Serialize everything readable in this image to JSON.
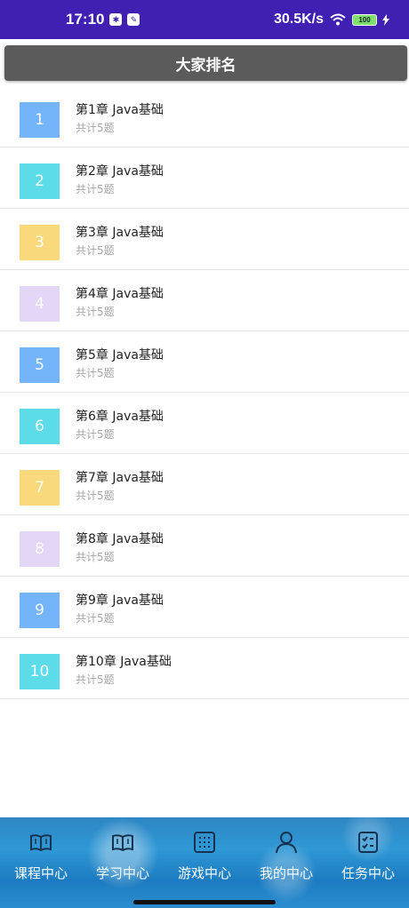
{
  "status_bar": {
    "time": "17:10",
    "icons": [
      "settings-mini-icon",
      "app-mini-icon"
    ],
    "network_speed": "30.5K/s",
    "battery": "100"
  },
  "header": {
    "title": "大家排名"
  },
  "chapters": [
    {
      "number": "1",
      "title": "第1章 Java基础",
      "subtitle": "共计5题",
      "color": "#74b4fb"
    },
    {
      "number": "2",
      "title": "第2章 Java基础",
      "subtitle": "共计5题",
      "color": "#5cdbe8"
    },
    {
      "number": "3",
      "title": "第3章 Java基础",
      "subtitle": "共计5题",
      "color": "#f9d97b"
    },
    {
      "number": "4",
      "title": "第4章 Java基础",
      "subtitle": "共计5题",
      "color": "#e3d6f7"
    },
    {
      "number": "5",
      "title": "第5章 Java基础",
      "subtitle": "共计5题",
      "color": "#74b4fb"
    },
    {
      "number": "6",
      "title": "第6章 Java基础",
      "subtitle": "共计5题",
      "color": "#5cdbe8"
    },
    {
      "number": "7",
      "title": "第7章 Java基础",
      "subtitle": "共计5题",
      "color": "#f9d97b"
    },
    {
      "number": "8",
      "title": "第8章 Java基础",
      "subtitle": "共计5题",
      "color": "#e3d6f7"
    },
    {
      "number": "9",
      "title": "第9章 Java基础",
      "subtitle": "共计5题",
      "color": "#74b4fb"
    },
    {
      "number": "10",
      "title": "第10章 Java基础",
      "subtitle": "共计5题",
      "color": "#5cdbe8"
    }
  ],
  "bottom_nav": [
    {
      "label": "课程中心",
      "icon": "book-icon"
    },
    {
      "label": "学习中心",
      "icon": "book-icon"
    },
    {
      "label": "游戏中心",
      "icon": "grid-icon"
    },
    {
      "label": "我的中心",
      "icon": "person-icon"
    },
    {
      "label": "任务中心",
      "icon": "checklist-icon"
    }
  ]
}
